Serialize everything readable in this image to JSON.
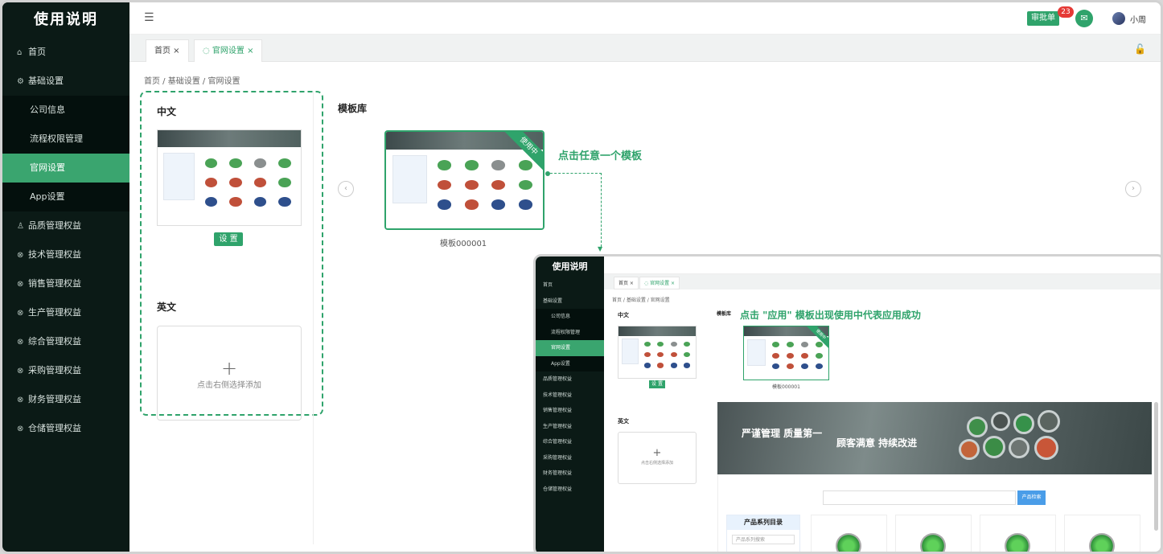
{
  "app_title": "使用说明",
  "sidebar": {
    "items": [
      {
        "icon": "⌂",
        "label": "首页"
      },
      {
        "icon": "⚙",
        "label": "基础设置"
      },
      {
        "label": "公司信息"
      },
      {
        "label": "流程权限管理"
      },
      {
        "label": "官网设置"
      },
      {
        "label": "App设置"
      },
      {
        "icon": "♙",
        "label": "品质管理权益"
      },
      {
        "icon": "⊗",
        "label": "技术管理权益"
      },
      {
        "icon": "⊗",
        "label": "销售管理权益"
      },
      {
        "icon": "⊗",
        "label": "生产管理权益"
      },
      {
        "icon": "⊗",
        "label": "综合管理权益"
      },
      {
        "icon": "⊗",
        "label": "采购管理权益"
      },
      {
        "icon": "⊗",
        "label": "财务管理权益"
      },
      {
        "icon": "⊗",
        "label": "仓储管理权益"
      }
    ]
  },
  "header": {
    "approve_label": "审批单",
    "badge_count": "23",
    "user_name": "小周"
  },
  "tabs": [
    {
      "label": "首页 ×"
    },
    {
      "label": "◌ 官网设置 ×"
    }
  ],
  "breadcrumb": "首页 / 基础设置 / 官网设置",
  "left_panel": {
    "zh_title": "中文",
    "set_button": "设 置",
    "en_title": "英文",
    "add_hint": "点击右侧选择添加",
    "plus": "+"
  },
  "library": {
    "title": "模板库",
    "template_name": "模板000001",
    "ribbon": "使用中",
    "hint": "点击任意一个模板"
  },
  "inset": {
    "hint": "点击 \"应用\" 模板出现使用中代表应用成功",
    "banner_text1": "严谨管理  质量第一",
    "banner_text2": "顾客满意  持续改进",
    "search_button": "产品检索",
    "category_title": "产品系列目录",
    "category_placeholder": "产品系列搜索"
  },
  "colors": {
    "accent": "#2fa36b",
    "sidebar_bg": "#0b1a16"
  }
}
